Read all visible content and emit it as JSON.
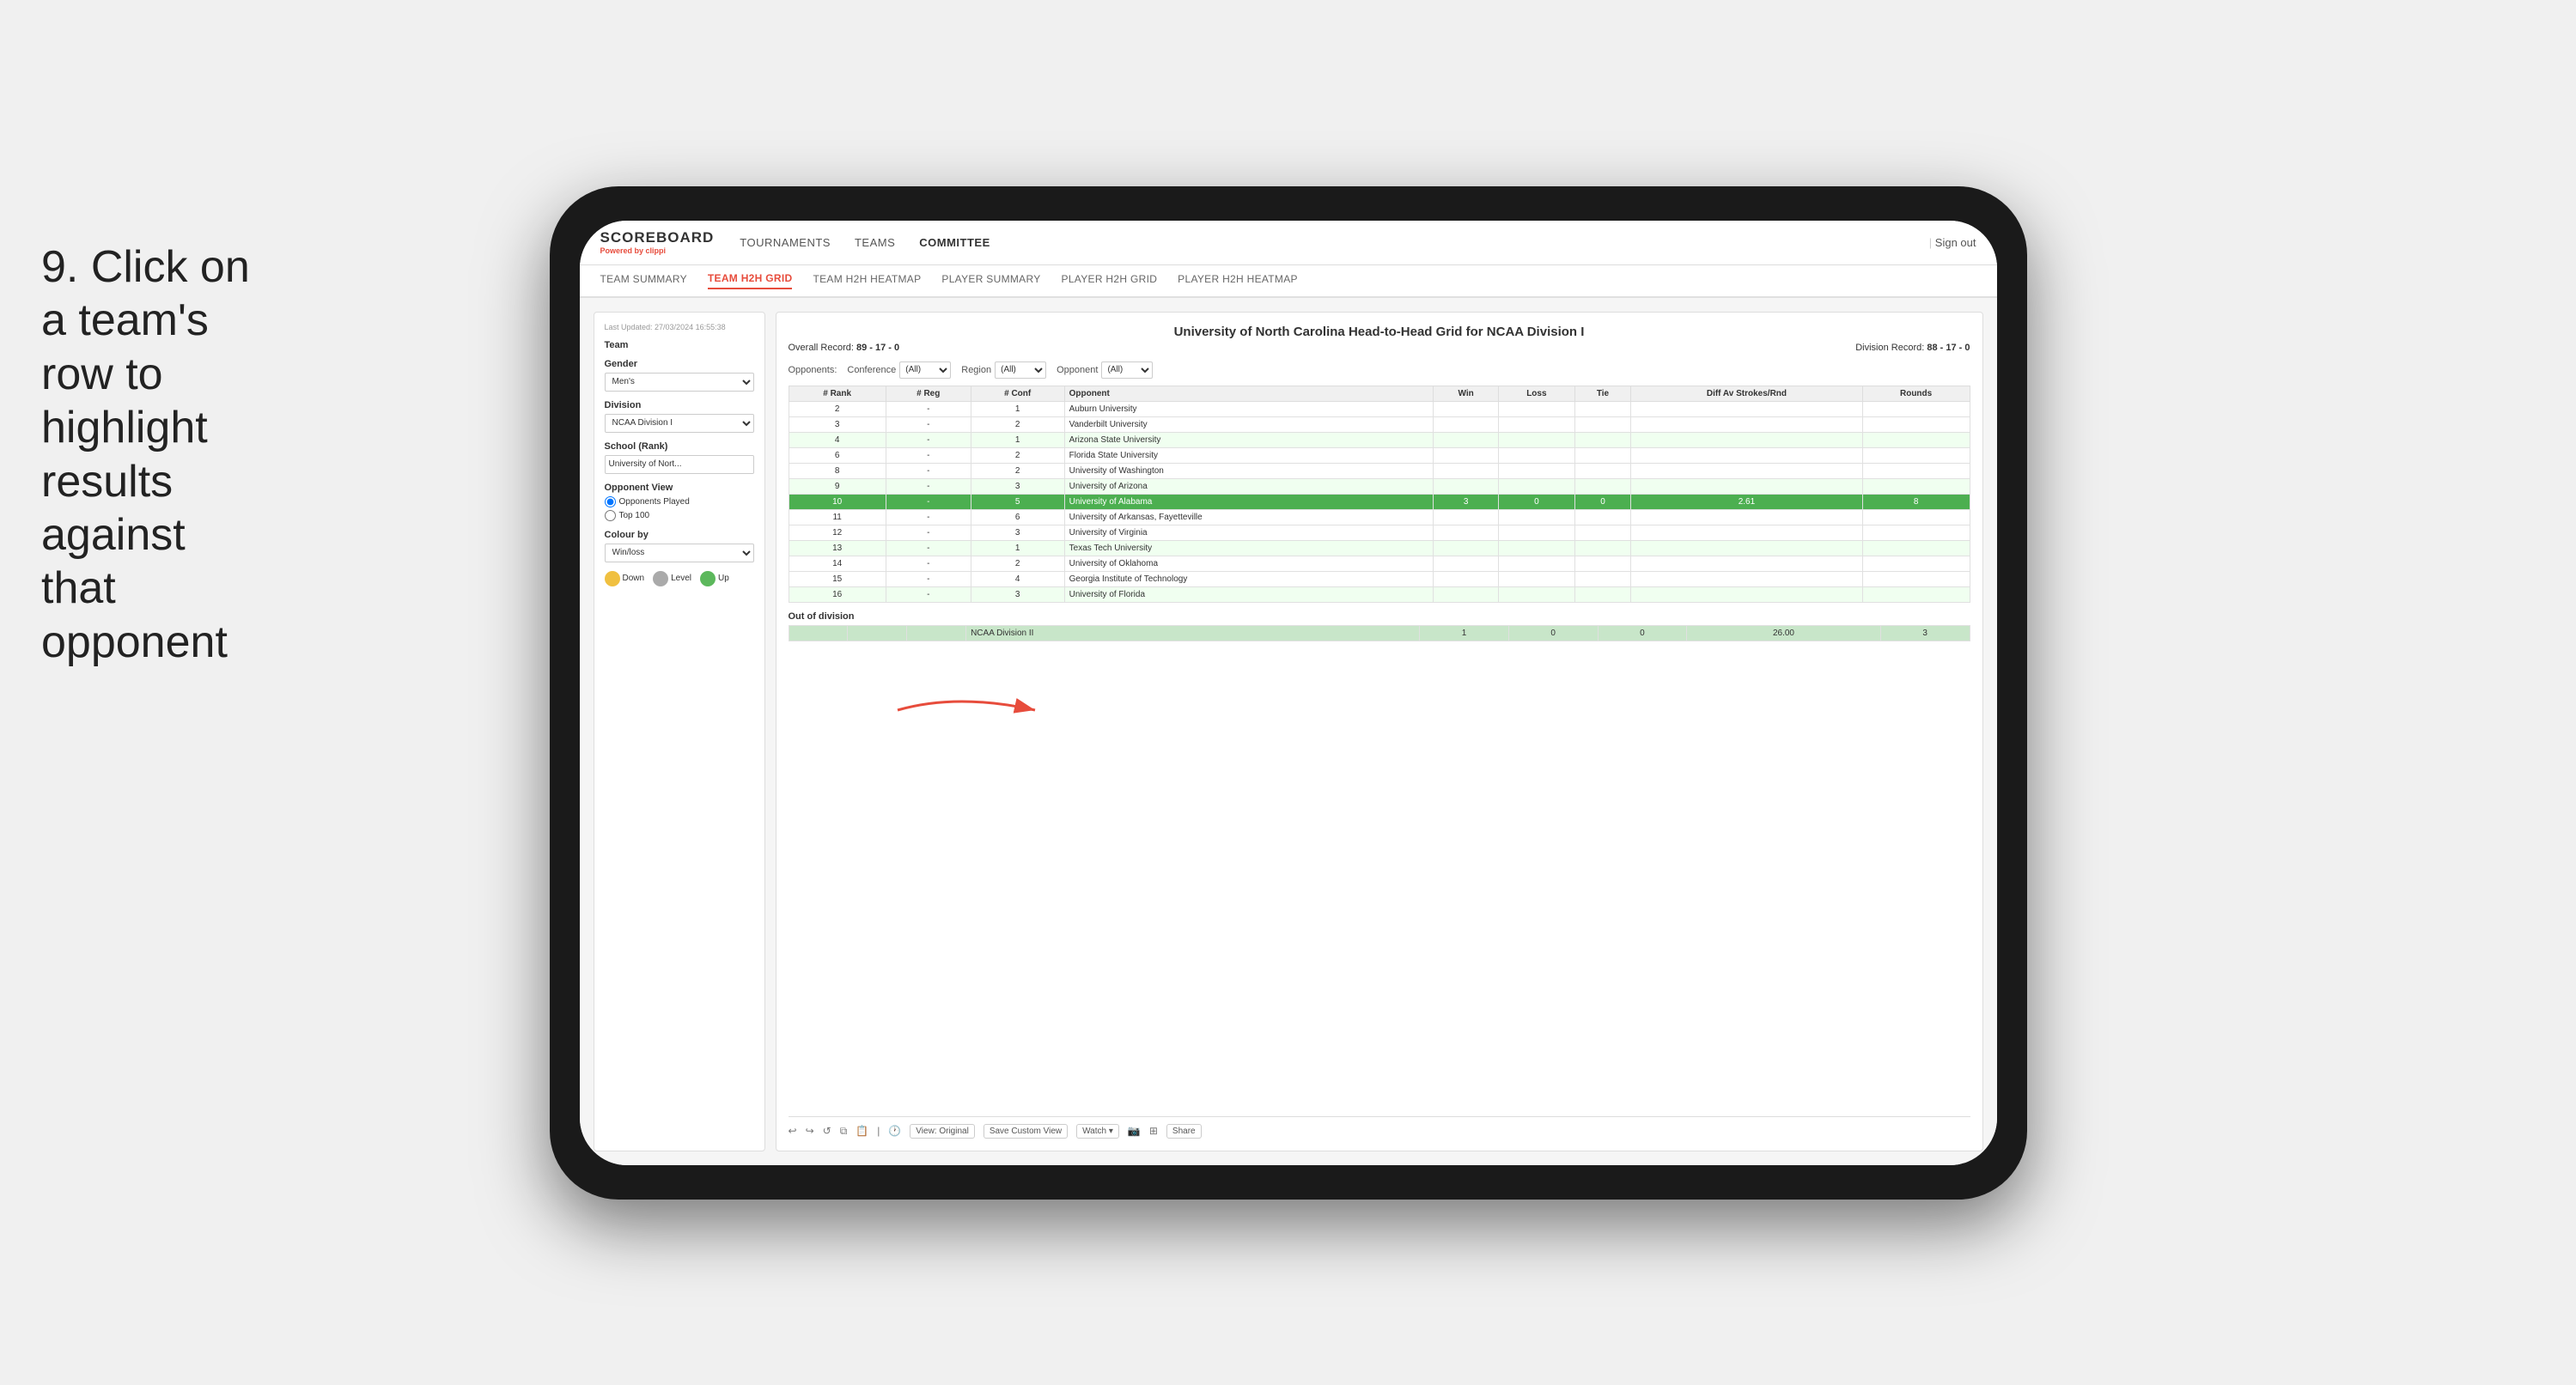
{
  "instruction": {
    "number": "9.",
    "text": "Click on a team's row to highlight results against that opponent"
  },
  "app": {
    "logo": "SCOREBOARD",
    "powered_by": "Powered by",
    "brand": "clippi",
    "sign_out": "Sign out"
  },
  "nav": {
    "items": [
      {
        "label": "TOURNAMENTS",
        "active": false
      },
      {
        "label": "TEAMS",
        "active": false
      },
      {
        "label": "COMMITTEE",
        "active": true
      }
    ]
  },
  "sub_nav": {
    "items": [
      {
        "label": "TEAM SUMMARY",
        "active": false
      },
      {
        "label": "TEAM H2H GRID",
        "active": true
      },
      {
        "label": "TEAM H2H HEATMAP",
        "active": false
      },
      {
        "label": "PLAYER SUMMARY",
        "active": false
      },
      {
        "label": "PLAYER H2H GRID",
        "active": false
      },
      {
        "label": "PLAYER H2H HEATMAP",
        "active": false
      }
    ]
  },
  "left_panel": {
    "timestamp": "Last Updated: 27/03/2024 16:55:38",
    "team_label": "Team",
    "gender_label": "Gender",
    "gender_value": "Men's",
    "division_label": "Division",
    "division_value": "NCAA Division I",
    "school_label": "School (Rank)",
    "school_value": "University of Nort...",
    "opponent_view_label": "Opponent View",
    "radio_options": [
      "Opponents Played",
      "Top 100"
    ],
    "radio_selected": "Opponents Played",
    "colour_by_label": "Colour by",
    "colour_by_value": "Win/loss",
    "legend": [
      {
        "label": "Down",
        "color": "yellow"
      },
      {
        "label": "Level",
        "color": "gray"
      },
      {
        "label": "Up",
        "color": "green"
      }
    ]
  },
  "grid": {
    "title": "University of North Carolina Head-to-Head Grid for NCAA Division I",
    "overall_record_label": "Overall Record:",
    "overall_record": "89 - 17 - 0",
    "division_record_label": "Division Record:",
    "division_record": "88 - 17 - 0",
    "filters": {
      "opponents_label": "Opponents:",
      "conference_label": "Conference",
      "conference_value": "(All)",
      "region_label": "Region",
      "region_value": "(All)",
      "opponent_label": "Opponent",
      "opponent_value": "(All)"
    },
    "table_headers": [
      "# Rank",
      "# Reg",
      "# Conf",
      "Opponent",
      "Win",
      "Loss",
      "Tie",
      "Diff Av Strokes/Rnd",
      "Rounds"
    ],
    "rows": [
      {
        "rank": "2",
        "reg": "-",
        "conf": "1",
        "opponent": "Auburn University",
        "win": "",
        "loss": "",
        "tie": "",
        "diff": "",
        "rounds": "",
        "style": "normal"
      },
      {
        "rank": "3",
        "reg": "-",
        "conf": "2",
        "opponent": "Vanderbilt University",
        "win": "",
        "loss": "",
        "tie": "",
        "diff": "",
        "rounds": "",
        "style": "normal"
      },
      {
        "rank": "4",
        "reg": "-",
        "conf": "1",
        "opponent": "Arizona State University",
        "win": "",
        "loss": "",
        "tie": "",
        "diff": "",
        "rounds": "",
        "style": "light"
      },
      {
        "rank": "6",
        "reg": "-",
        "conf": "2",
        "opponent": "Florida State University",
        "win": "",
        "loss": "",
        "tie": "",
        "diff": "",
        "rounds": "",
        "style": "normal"
      },
      {
        "rank": "8",
        "reg": "-",
        "conf": "2",
        "opponent": "University of Washington",
        "win": "",
        "loss": "",
        "tie": "",
        "diff": "",
        "rounds": "",
        "style": "normal"
      },
      {
        "rank": "9",
        "reg": "-",
        "conf": "3",
        "opponent": "University of Arizona",
        "win": "",
        "loss": "",
        "tie": "",
        "diff": "",
        "rounds": "",
        "style": "light"
      },
      {
        "rank": "10",
        "reg": "-",
        "conf": "5",
        "opponent": "University of Alabama",
        "win": "3",
        "loss": "0",
        "tie": "0",
        "diff": "2.61",
        "rounds": "8",
        "style": "selected"
      },
      {
        "rank": "11",
        "reg": "-",
        "conf": "6",
        "opponent": "University of Arkansas, Fayetteville",
        "win": "",
        "loss": "",
        "tie": "",
        "diff": "",
        "rounds": "",
        "style": "normal"
      },
      {
        "rank": "12",
        "reg": "-",
        "conf": "3",
        "opponent": "University of Virginia",
        "win": "",
        "loss": "",
        "tie": "",
        "diff": "",
        "rounds": "",
        "style": "normal"
      },
      {
        "rank": "13",
        "reg": "-",
        "conf": "1",
        "opponent": "Texas Tech University",
        "win": "",
        "loss": "",
        "tie": "",
        "diff": "",
        "rounds": "",
        "style": "light"
      },
      {
        "rank": "14",
        "reg": "-",
        "conf": "2",
        "opponent": "University of Oklahoma",
        "win": "",
        "loss": "",
        "tie": "",
        "diff": "",
        "rounds": "",
        "style": "normal"
      },
      {
        "rank": "15",
        "reg": "-",
        "conf": "4",
        "opponent": "Georgia Institute of Technology",
        "win": "",
        "loss": "",
        "tie": "",
        "diff": "",
        "rounds": "",
        "style": "normal"
      },
      {
        "rank": "16",
        "reg": "-",
        "conf": "3",
        "opponent": "University of Florida",
        "win": "",
        "loss": "",
        "tie": "",
        "diff": "",
        "rounds": "",
        "style": "light"
      }
    ],
    "out_of_division_label": "Out of division",
    "out_of_division_row": {
      "label": "NCAA Division II",
      "win": "1",
      "loss": "0",
      "tie": "0",
      "diff": "26.00",
      "rounds": "3"
    }
  },
  "toolbar": {
    "view_label": "View: Original",
    "save_custom": "Save Custom View",
    "watch": "Watch ▾",
    "share": "Share"
  },
  "colors": {
    "accent_red": "#e74c3c",
    "selected_green": "#4caf50",
    "light_green_bg": "#d4edda",
    "header_bg": "#f0f0f0"
  }
}
